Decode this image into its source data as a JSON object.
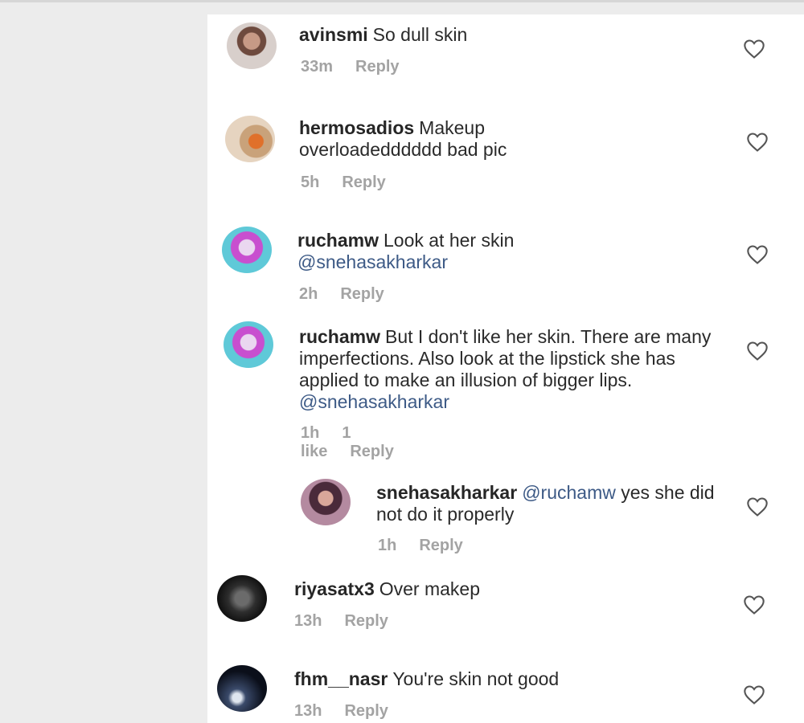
{
  "comments": [
    {
      "username": "avinsmi",
      "body": "So dull skin",
      "time": "33m",
      "likes": "",
      "reply": "Reply",
      "mention": ""
    },
    {
      "username": "hermosadios",
      "body": "Makeup overloadedddddd bad pic",
      "time": "5h",
      "likes": "",
      "reply": "Reply",
      "mention": ""
    },
    {
      "username": "ruchamw",
      "body": "Look at her skin",
      "time": "2h",
      "likes": "",
      "reply": "Reply",
      "mention": "@snehasakharkar"
    },
    {
      "username": "ruchamw",
      "body": "But I don't like her skin. There are many imperfections. Also look at the lipstick she has applied to make an illusion of bigger lips.",
      "time": "1h",
      "likes": "1 like",
      "reply": "Reply",
      "mention": "@snehasakharkar"
    },
    {
      "username": "snehasakharkar",
      "body": "yes she did not do it properly",
      "time": "1h",
      "likes": "",
      "reply": "Reply",
      "mention": "@ruchamw"
    },
    {
      "username": "riyasatx3",
      "body": "Over makep",
      "time": "13h",
      "likes": "",
      "reply": "Reply",
      "mention": ""
    },
    {
      "username": "fhm__nasr",
      "body": "You're skin not good",
      "time": "13h",
      "likes": "",
      "reply": "Reply",
      "mention": ""
    }
  ],
  "colors": {
    "accent_mention": "#3d5a86",
    "meta_gray": "#a3a3a3"
  },
  "icons": {
    "like": "heart-outline-icon"
  }
}
